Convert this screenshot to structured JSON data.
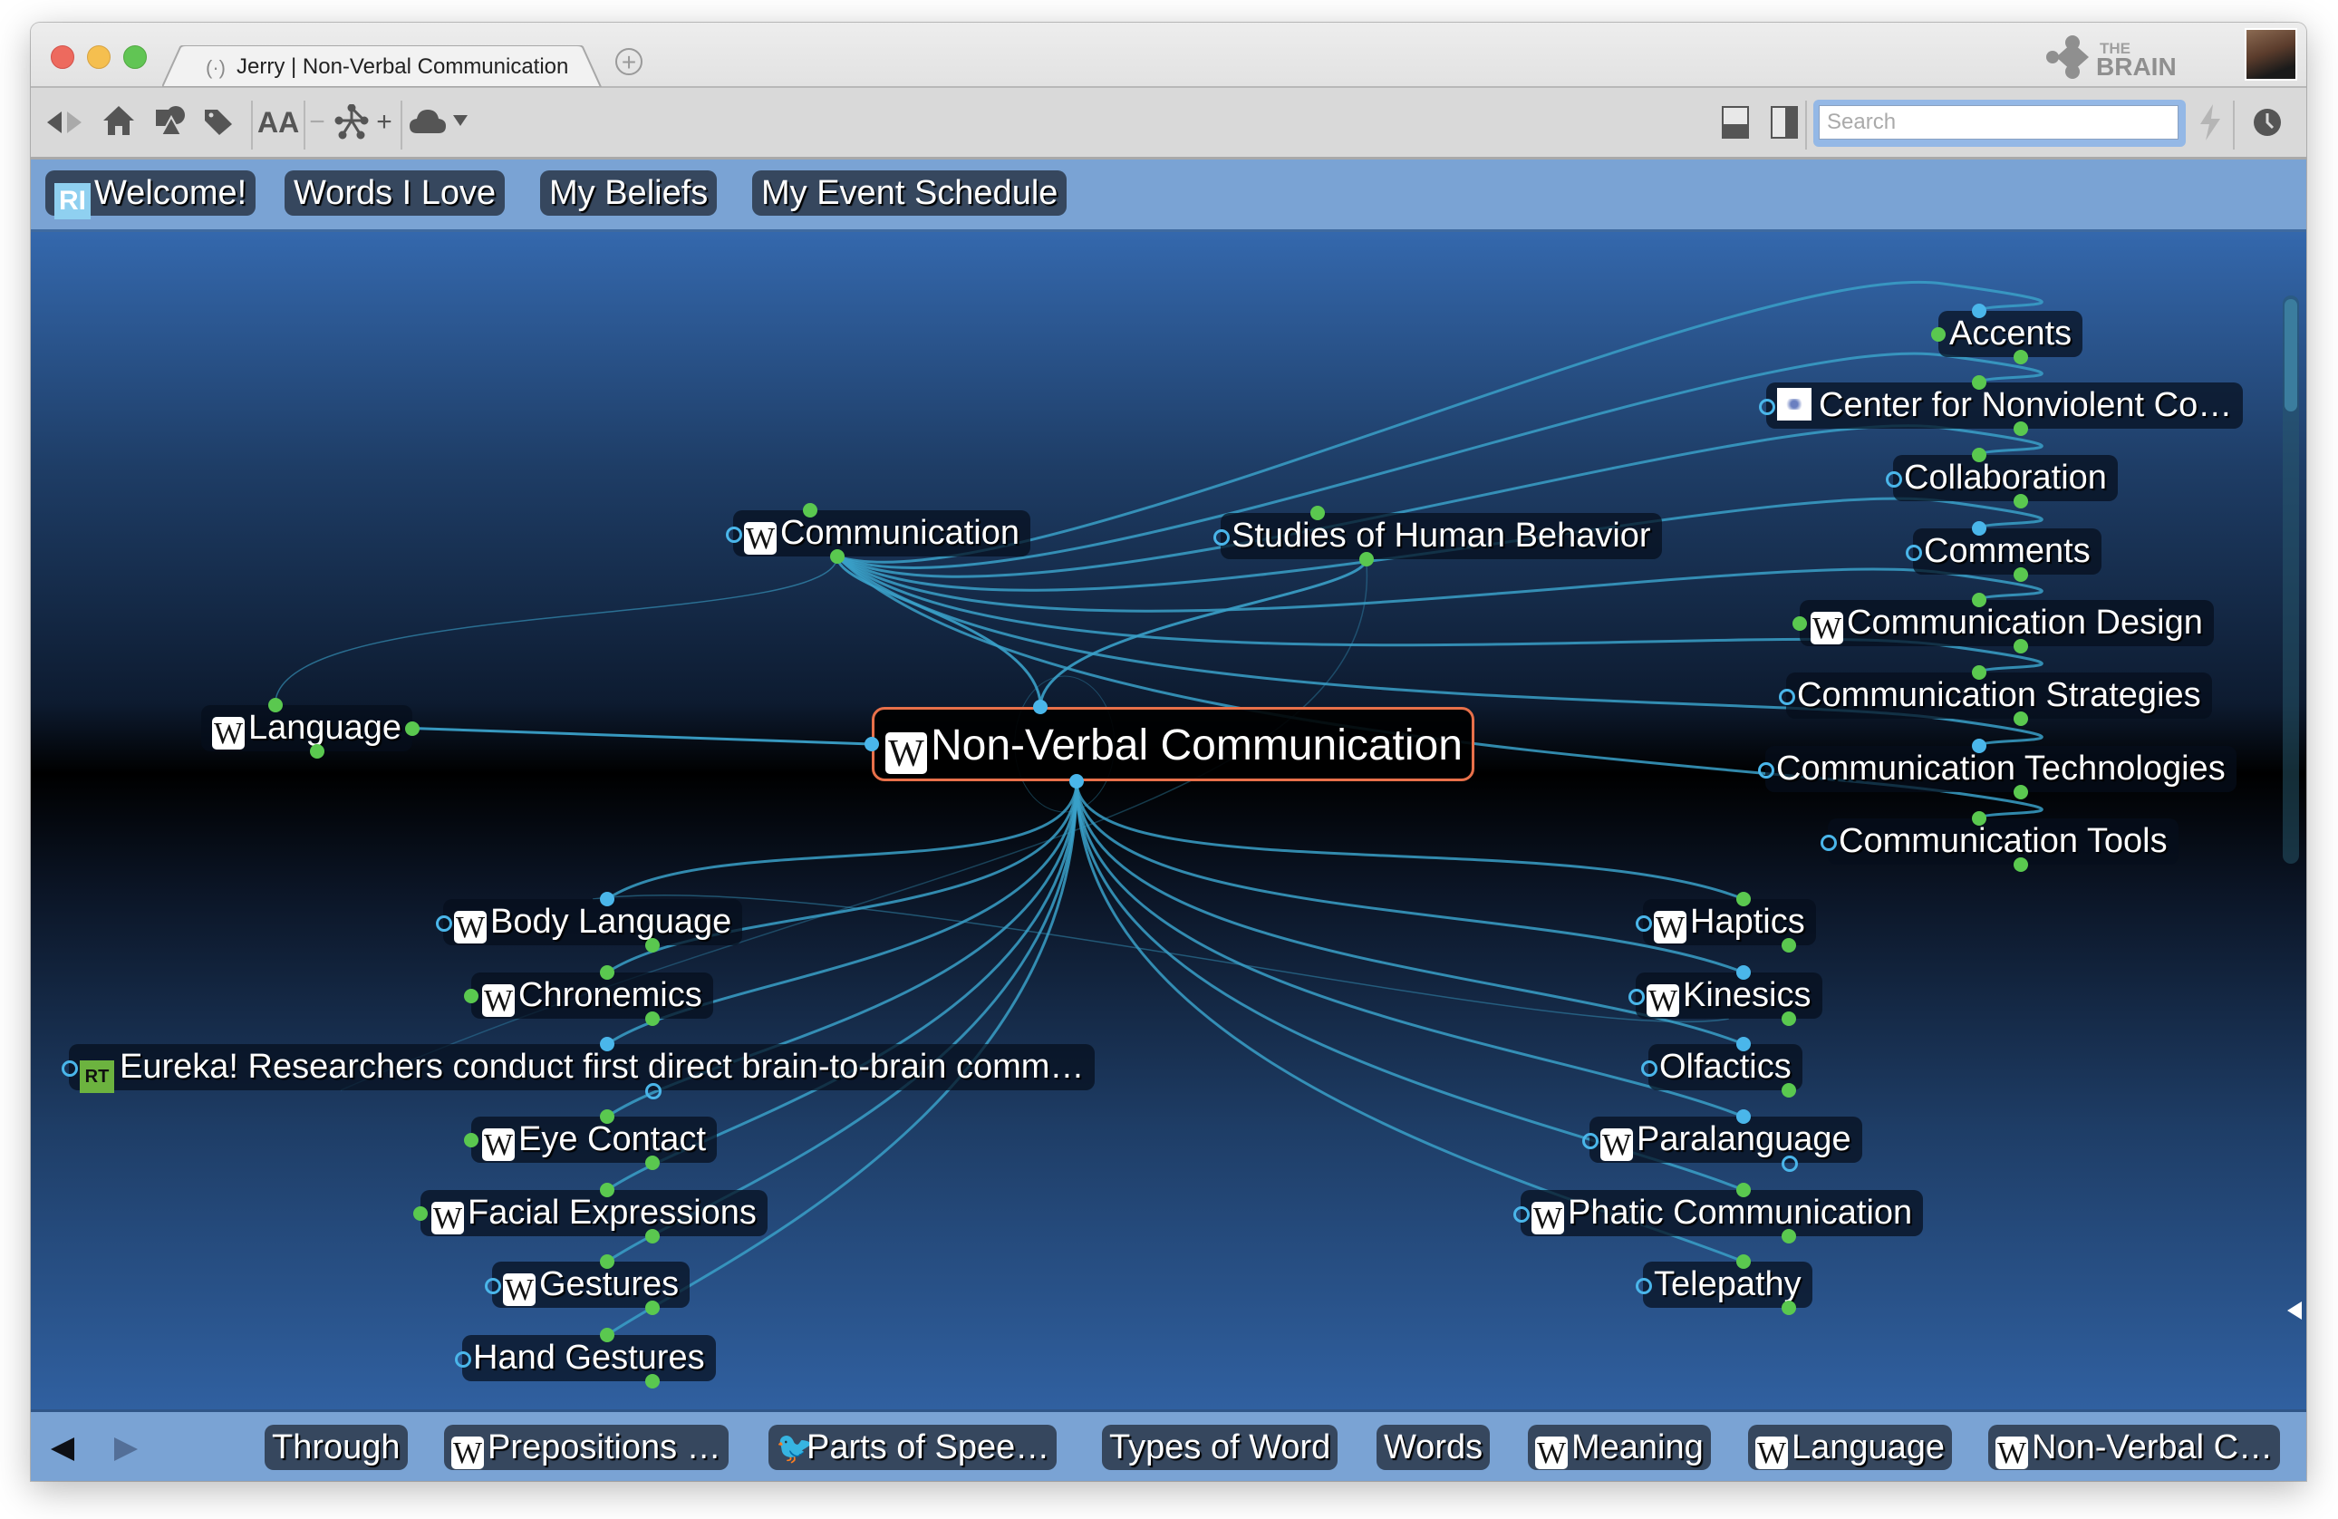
{
  "window": {
    "tab_title": "Jerry | Non-Verbal Communication",
    "tab_icon": "broadcast-icon",
    "brand": {
      "top": "THE",
      "bottom": "BRAIN"
    }
  },
  "toolbar": {
    "icons": [
      "back-icon",
      "forward-icon",
      "home-icon",
      "shapes-icon",
      "tag-icon",
      "font-size-icon",
      "zoom-out-icon",
      "thought-network-icon",
      "zoom-in-icon",
      "cloud-sync-icon",
      "dropdown-icon"
    ],
    "font_label": "AA",
    "minus": "−",
    "plus": "+",
    "right_icons": [
      "layout-bottom-icon",
      "layout-right-icon",
      "lightning-icon",
      "history-clock-icon"
    ],
    "search_placeholder": "Search",
    "search_value": ""
  },
  "pins": [
    {
      "label": "Welcome!",
      "icon": "rb-logo"
    },
    {
      "label": "Words I Love"
    },
    {
      "label": "My Beliefs"
    },
    {
      "label": "My Event Schedule"
    }
  ],
  "brain": {
    "active": {
      "label": "Non-Verbal Communication",
      "icon": "W"
    },
    "parents": [
      {
        "label": "Communication",
        "icon": "W"
      },
      {
        "label": "Studies of Human Behavior"
      }
    ],
    "jumps": [
      {
        "label": "Language",
        "icon": "W"
      }
    ],
    "siblings": [
      {
        "label": "Accents"
      },
      {
        "label": "Center for Nonviolent Co…",
        "icon": "image"
      },
      {
        "label": "Collaboration"
      },
      {
        "label": "Comments"
      },
      {
        "label": "Communication Design",
        "icon": "W"
      },
      {
        "label": "Communication Strategies"
      },
      {
        "label": "Communication Technologies"
      },
      {
        "label": "Communication Tools"
      }
    ],
    "children_left": [
      {
        "label": "Body Language",
        "icon": "W"
      },
      {
        "label": "Chronemics",
        "icon": "W"
      },
      {
        "label": "Eureka! Researchers conduct first direct brain-to-brain comm…",
        "icon": "RT"
      },
      {
        "label": "Eye Contact",
        "icon": "W"
      },
      {
        "label": "Facial Expressions",
        "icon": "W"
      },
      {
        "label": "Gestures",
        "icon": "W"
      },
      {
        "label": "Hand Gestures"
      }
    ],
    "children_right": [
      {
        "label": "Haptics",
        "icon": "W"
      },
      {
        "label": "Kinesics",
        "icon": "W"
      },
      {
        "label": "Olfactics"
      },
      {
        "label": "Paralanguage",
        "icon": "W"
      },
      {
        "label": "Phatic Communication",
        "icon": "W"
      },
      {
        "label": "Telepathy"
      }
    ]
  },
  "history": [
    {
      "label": "Through"
    },
    {
      "label": "Prepositions …",
      "icon": "W"
    },
    {
      "label": "Parts of Spee…",
      "icon": "bird"
    },
    {
      "label": "Types of Word"
    },
    {
      "label": "Words"
    },
    {
      "label": "Meaning",
      "icon": "W"
    },
    {
      "label": "Language",
      "icon": "W"
    },
    {
      "label": "Non-Verbal C…",
      "icon": "W"
    }
  ],
  "icon_glyphs": {
    "W": "W",
    "RT": "RT",
    "RB": "RI"
  },
  "colors": {
    "link": "#3aa0c8",
    "gate_green": "#5ac84f",
    "gate_blue": "#4ab6ea",
    "active_border": "#e8704a",
    "pin_bar": "#7aa3d4"
  }
}
